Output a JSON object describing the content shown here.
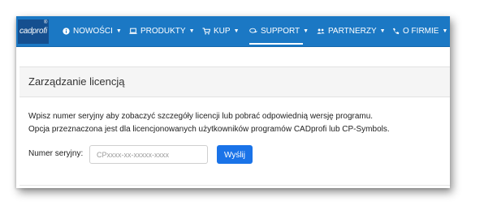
{
  "brand": {
    "logo_text": "cadprofi",
    "registered": "®"
  },
  "nav": {
    "items": [
      {
        "label": "NOWOŚCI",
        "icon": "info-circle-icon",
        "caret": "▼"
      },
      {
        "label": "PRODUKTY",
        "icon": "laptop-icon",
        "caret": "▼"
      },
      {
        "label": "KUP",
        "icon": "cart-icon",
        "caret": "▼"
      },
      {
        "label": "SUPPORT",
        "icon": "chat-bubbles-icon",
        "caret": "▼",
        "active": true
      },
      {
        "label": "PARTNERZY",
        "icon": "users-icon",
        "caret": "▼"
      },
      {
        "label": "O FIRMIE",
        "icon": "phone-icon",
        "caret": "▼"
      }
    ]
  },
  "panel": {
    "title": "Zarządzanie licencją",
    "description_line1": "Wpisz numer seryjny aby zobaczyć szczegóły licencji lub pobrać odpowiednią wersję programu.",
    "description_line2": "Opcja przeznaczona jest dla licencjonowanych użytkowników programów CADprofi lub CP-Symbols.",
    "serial_label": "Numer seryjny:",
    "serial_placeholder": "CPxxxx-xx-xxxxx-xxxx",
    "serial_value": "",
    "submit_label": "Wyślij"
  },
  "colors": {
    "navbar": "#1b78c4",
    "button": "#1a73e8",
    "panel_header": "#f5f5f5"
  }
}
